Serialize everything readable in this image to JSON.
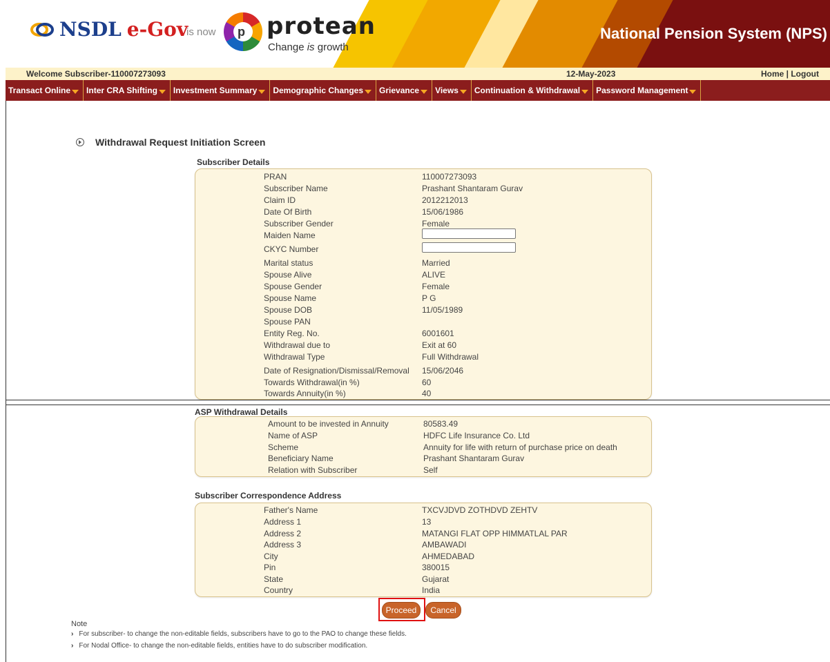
{
  "header": {
    "brand_nsdl": "NSDL",
    "brand_egov": "e-Gov",
    "is_now": "is now",
    "brand_protean": "protean",
    "tagline_pre": "Change ",
    "tagline_is": "is",
    "tagline_post": " growth",
    "title": "National Pension System (NPS)"
  },
  "welcome": {
    "user": "Welcome Subscriber-110007273093",
    "date": "12-May-2023",
    "home": "Home",
    "separator": " | ",
    "logout": "Logout"
  },
  "menu": [
    {
      "label": "Transact Online"
    },
    {
      "label": "Inter CRA Shifting"
    },
    {
      "label": "Investment Summary"
    },
    {
      "label": "Demographic Changes"
    },
    {
      "label": "Grievance"
    },
    {
      "label": "Views"
    },
    {
      "label": "Continuation & Withdrawal"
    },
    {
      "label": "Password Management"
    }
  ],
  "page_title": "Withdrawal Request Initiation Screen",
  "subscriber_details": {
    "title": "Subscriber Details",
    "rows": [
      {
        "label": "PRAN",
        "value": "110007273093"
      },
      {
        "label": "Subscriber Name",
        "value": "Prashant Shantaram Gurav"
      },
      {
        "label": "Claim ID",
        "value": "2012212013"
      },
      {
        "label": "Date Of Birth",
        "value": "15/06/1986"
      },
      {
        "label": "Subscriber Gender",
        "value": "Female"
      },
      {
        "label": "Maiden Name",
        "value": ""
      },
      {
        "label": "CKYC Number",
        "value": ""
      },
      {
        "label": "Marital status",
        "value": "Married"
      },
      {
        "label": "Spouse Alive",
        "value": "ALIVE"
      },
      {
        "label": "Spouse Gender",
        "value": "Female"
      },
      {
        "label": "Spouse Name",
        "value": "P G"
      },
      {
        "label": "Spouse DOB",
        "value": "11/05/1989"
      },
      {
        "label": "Spouse PAN",
        "value": ""
      },
      {
        "label": "Entity Reg. No.",
        "value": "6001601"
      },
      {
        "label": "Withdrawal due to",
        "value": "Exit at 60"
      },
      {
        "label": "Withdrawal Type",
        "value": "Full Withdrawal"
      },
      {
        "label": "Date of Resignation/Dismissal/Removal",
        "value": "15/06/2046"
      },
      {
        "label": "Towards Withdrawal(in %)",
        "value": "60"
      },
      {
        "label": "Towards Annuity(in %)",
        "value": "40"
      }
    ]
  },
  "asp_details": {
    "title": "ASP Withdrawal Details",
    "rows": [
      {
        "label": "Amount to be invested in Annuity",
        "value": "80583.49"
      },
      {
        "label": "Name of ASP",
        "value": "HDFC Life Insurance Co. Ltd"
      },
      {
        "label": "Scheme",
        "value": "Annuity for life with return of purchase price on death"
      },
      {
        "label": "Beneficiary Name",
        "value": "Prashant Shantaram Gurav"
      },
      {
        "label": "Relation with Subscriber",
        "value": "Self"
      }
    ]
  },
  "address": {
    "title": "Subscriber Correspondence Address",
    "rows": [
      {
        "label": "Father's Name",
        "value": "TXCVJDVD ZOTHDVD ZEHTV"
      },
      {
        "label": "Address 1",
        "value": "13"
      },
      {
        "label": "Address 2",
        "value": "MATANGI FLAT OPP HIMMATLAL PAR"
      },
      {
        "label": "Address 3",
        "value": "AMBAWADI"
      },
      {
        "label": "City",
        "value": "AHMEDABAD"
      },
      {
        "label": "Pin",
        "value": "380015"
      },
      {
        "label": "State",
        "value": "Gujarat"
      },
      {
        "label": "Country",
        "value": "India"
      }
    ]
  },
  "buttons": {
    "proceed": "Proceed",
    "cancel": "Cancel"
  },
  "note": {
    "title": "Note",
    "lines": [
      "For subscriber- to change the non-editable fields, subscribers have to go to the PAO to change these fields.",
      "For Nodal Office- to change the non-editable fields, entities have to do subscriber modification."
    ]
  },
  "colors": {
    "brand_maroon": "#7a1010",
    "menu_bg": "#8b1d1d",
    "button": "#c8642a",
    "panel": "#fdf6e0",
    "highlight": "#e01010"
  }
}
